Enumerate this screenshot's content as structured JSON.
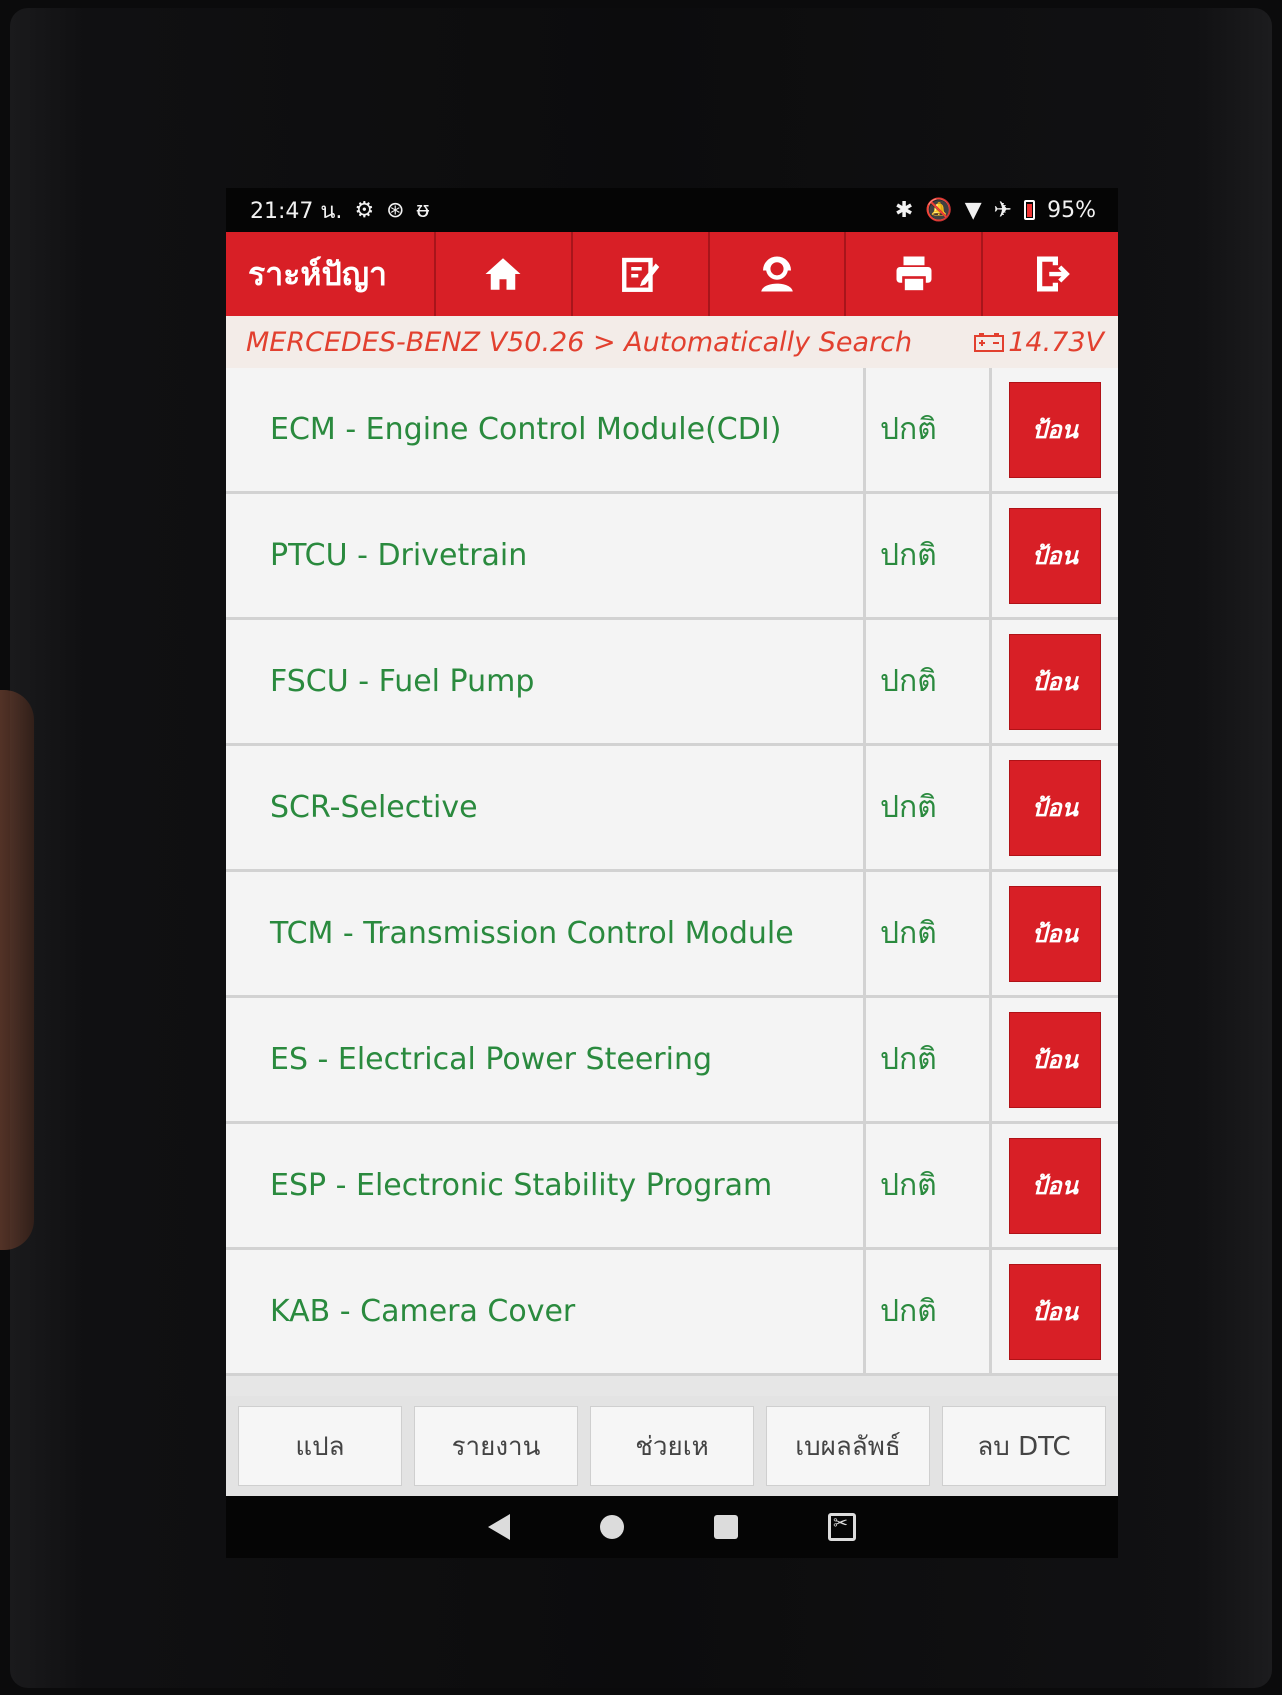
{
  "status_bar": {
    "time": "21:47 น.",
    "battery": "95%"
  },
  "toolbar": {
    "title": "ราะห์ปัญา",
    "buttons": [
      {
        "icon": "home-icon"
      },
      {
        "icon": "edit-note-icon"
      },
      {
        "icon": "support-agent-icon"
      },
      {
        "icon": "printer-icon"
      },
      {
        "icon": "exit-icon"
      }
    ]
  },
  "breadcrumb": {
    "path": "MERCEDES-BENZ V50.26 > Automatically Search",
    "voltage": "14.73V"
  },
  "modules": [
    {
      "name": "ECM - Engine Control Module(CDI)",
      "status": "ปกติ",
      "action": "ป้อน"
    },
    {
      "name": "PTCU - Drivetrain",
      "status": "ปกติ",
      "action": "ป้อน"
    },
    {
      "name": "FSCU - Fuel Pump",
      "status": "ปกติ",
      "action": "ป้อน"
    },
    {
      "name": "SCR-Selective",
      "status": "ปกติ",
      "action": "ป้อน"
    },
    {
      "name": "TCM - Transmission Control Module",
      "status": "ปกติ",
      "action": "ป้อน"
    },
    {
      "name": "ES - Electrical Power Steering",
      "status": "ปกติ",
      "action": "ป้อน"
    },
    {
      "name": "ESP - Electronic Stability Program",
      "status": "ปกติ",
      "action": "ป้อน"
    },
    {
      "name": "KAB - Camera Cover",
      "status": "ปกติ",
      "action": "ป้อน"
    }
  ],
  "bottom_buttons": [
    "แปล",
    "รายงาน",
    "ช่วยเห",
    "เบผลลัพธ์",
    "ลบ DTC"
  ],
  "colors": {
    "accent": "#d81f26",
    "module_text": "#2a8a3e",
    "breadcrumb_text": "#e2402f"
  }
}
